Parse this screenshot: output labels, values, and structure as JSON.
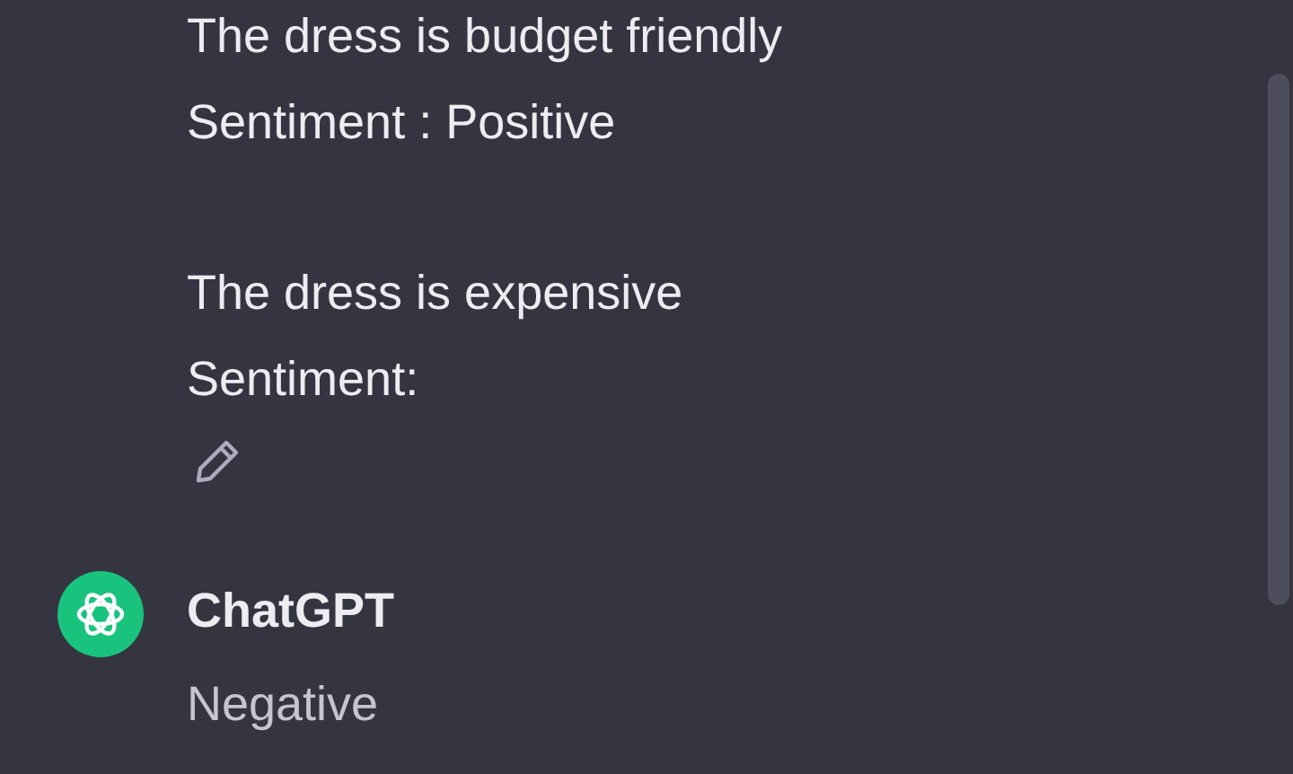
{
  "user_message": {
    "paragraphs": [
      {
        "lines": [
          "The dress is budget friendly",
          "Sentiment : Positive"
        ]
      },
      {
        "lines": [
          "The dress is expensive",
          "Sentiment:"
        ]
      }
    ]
  },
  "assistant_message": {
    "author": "ChatGPT",
    "text": "Negative"
  }
}
